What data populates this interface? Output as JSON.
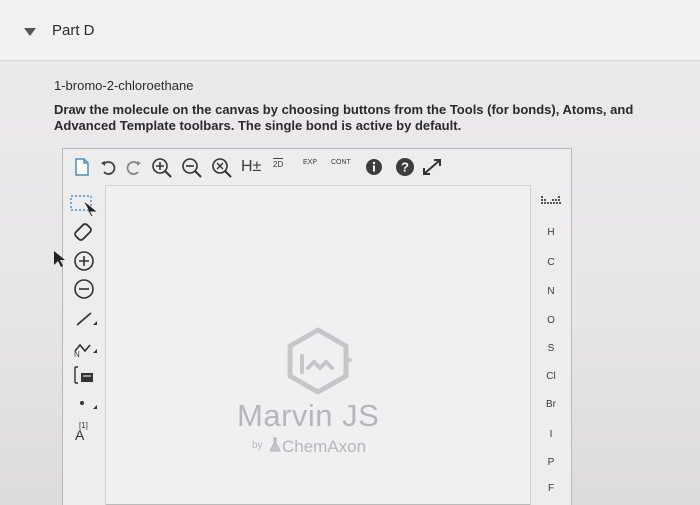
{
  "part": {
    "title": "Part D"
  },
  "question": {
    "molecule": "1-bromo-2-chloroethane",
    "instructions": "Draw the molecule on the canvas by choosing buttons from the Tools (for bonds), Atoms, and Advanced Template toolbars. The single bond is active by default."
  },
  "toolbar": {
    "hydrogen_label": "H±",
    "twod_label": "2D",
    "exp_label": "EXP",
    "cont_label": "CONT"
  },
  "atoms": [
    "H",
    "C",
    "N",
    "O",
    "S",
    "Cl",
    "Br",
    "I",
    "P",
    "F"
  ],
  "left_tools": {
    "charge_label": "[1]",
    "atom_label": "A"
  },
  "logo": {
    "name": "Marvin JS",
    "by": "by",
    "company": "ChemAxon"
  },
  "colors": {
    "info": "#3d3d3d",
    "page": "#e9e8ea"
  }
}
